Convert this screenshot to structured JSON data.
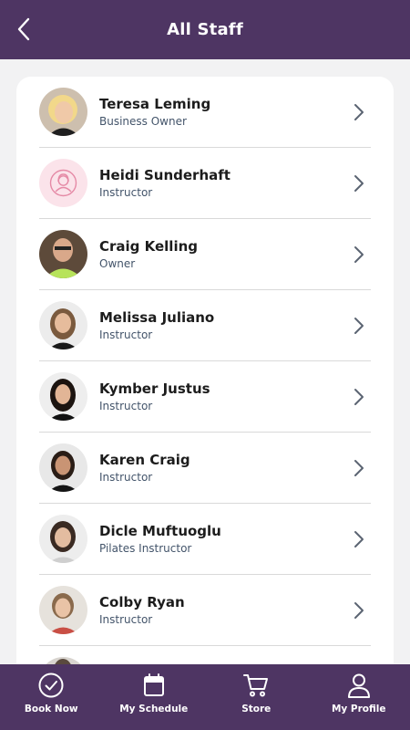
{
  "header": {
    "title": "All Staff"
  },
  "staff": [
    {
      "name": "Teresa Leming",
      "role": "Business Owner",
      "avatar": "photo"
    },
    {
      "name": "Heidi Sunderhaft",
      "role": "Instructor",
      "avatar": "placeholder"
    },
    {
      "name": "Craig Kelling",
      "role": "Owner",
      "avatar": "photo"
    },
    {
      "name": "Melissa Juliano",
      "role": "Instructor",
      "avatar": "photo"
    },
    {
      "name": "Kymber Justus",
      "role": "Instructor",
      "avatar": "photo"
    },
    {
      "name": "Karen Craig",
      "role": "Instructor",
      "avatar": "photo"
    },
    {
      "name": "Dicle Muftuoglu",
      "role": "Pilates Instructor",
      "avatar": "photo"
    },
    {
      "name": "Colby Ryan",
      "role": "Instructor",
      "avatar": "photo"
    }
  ],
  "bottom_nav": [
    {
      "label": "Book Now",
      "icon": "check-circle-icon"
    },
    {
      "label": "My Schedule",
      "icon": "calendar-icon"
    },
    {
      "label": "Store",
      "icon": "cart-icon"
    },
    {
      "label": "My Profile",
      "icon": "user-icon"
    }
  ],
  "colors": {
    "brand": "#4e3563",
    "placeholder_bg": "#fbe3ea",
    "placeholder_icon": "#e58aa6"
  }
}
